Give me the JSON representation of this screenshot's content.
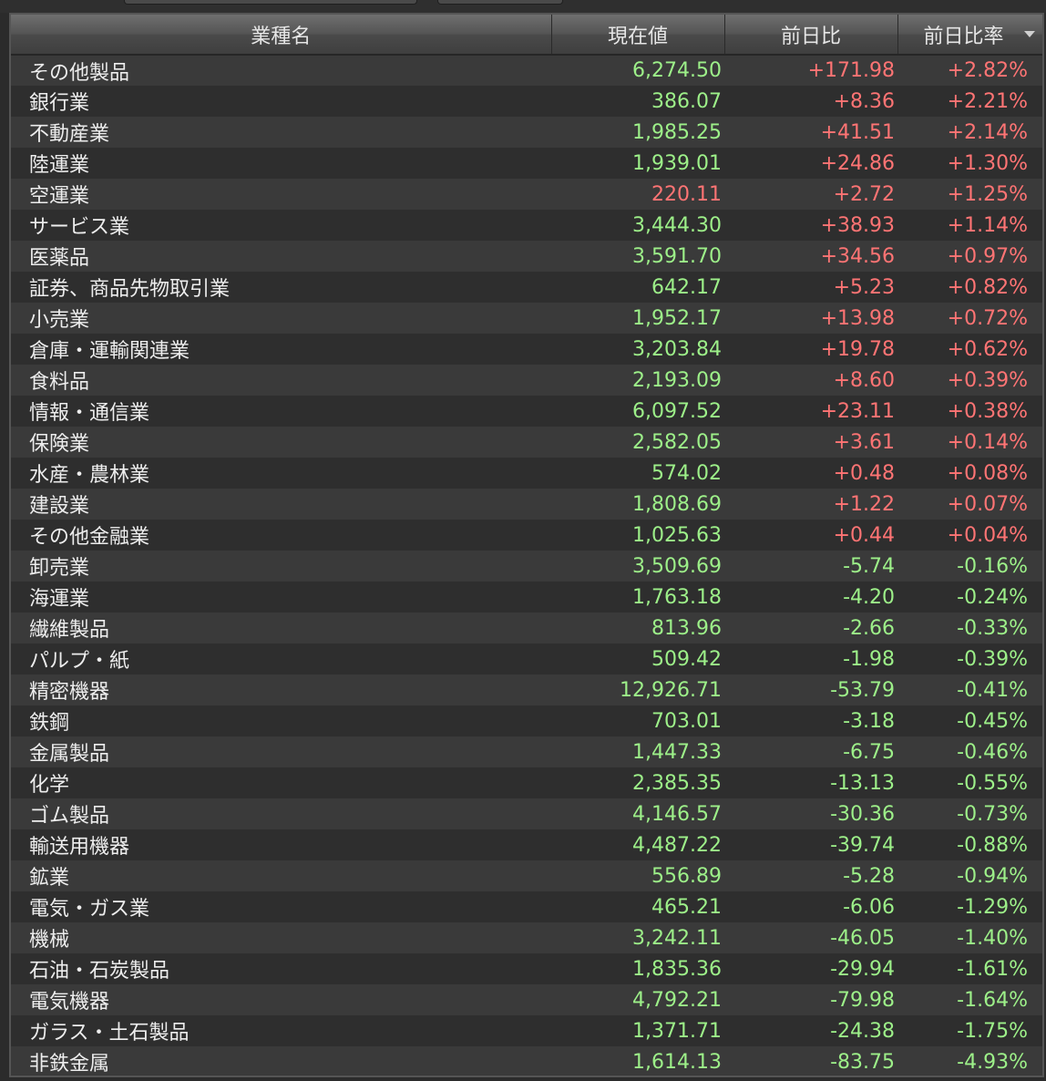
{
  "headers": {
    "name": "業種名",
    "price": "現在値",
    "change": "前日比",
    "pct": "前日比率"
  },
  "colors": {
    "up": "#ff7474",
    "down_or_price": "#9df089"
  },
  "rows": [
    {
      "name": "その他製品",
      "price": "6,274.50",
      "change": "+171.98",
      "pct": "+2.82%",
      "price_color": "green"
    },
    {
      "name": "銀行業",
      "price": "386.07",
      "change": "+8.36",
      "pct": "+2.21%",
      "price_color": "green"
    },
    {
      "name": "不動産業",
      "price": "1,985.25",
      "change": "+41.51",
      "pct": "+2.14%",
      "price_color": "green"
    },
    {
      "name": "陸運業",
      "price": "1,939.01",
      "change": "+24.86",
      "pct": "+1.30%",
      "price_color": "green"
    },
    {
      "name": "空運業",
      "price": "220.11",
      "change": "+2.72",
      "pct": "+1.25%",
      "price_color": "red"
    },
    {
      "name": "サービス業",
      "price": "3,444.30",
      "change": "+38.93",
      "pct": "+1.14%",
      "price_color": "green"
    },
    {
      "name": "医薬品",
      "price": "3,591.70",
      "change": "+34.56",
      "pct": "+0.97%",
      "price_color": "green"
    },
    {
      "name": "証券、商品先物取引業",
      "price": "642.17",
      "change": "+5.23",
      "pct": "+0.82%",
      "price_color": "green"
    },
    {
      "name": "小売業",
      "price": "1,952.17",
      "change": "+13.98",
      "pct": "+0.72%",
      "price_color": "green"
    },
    {
      "name": "倉庫・運輸関連業",
      "price": "3,203.84",
      "change": "+19.78",
      "pct": "+0.62%",
      "price_color": "green"
    },
    {
      "name": "食料品",
      "price": "2,193.09",
      "change": "+8.60",
      "pct": "+0.39%",
      "price_color": "green"
    },
    {
      "name": "情報・通信業",
      "price": "6,097.52",
      "change": "+23.11",
      "pct": "+0.38%",
      "price_color": "green"
    },
    {
      "name": "保険業",
      "price": "2,582.05",
      "change": "+3.61",
      "pct": "+0.14%",
      "price_color": "green"
    },
    {
      "name": "水産・農林業",
      "price": "574.02",
      "change": "+0.48",
      "pct": "+0.08%",
      "price_color": "green"
    },
    {
      "name": "建設業",
      "price": "1,808.69",
      "change": "+1.22",
      "pct": "+0.07%",
      "price_color": "green"
    },
    {
      "name": "その他金融業",
      "price": "1,025.63",
      "change": "+0.44",
      "pct": "+0.04%",
      "price_color": "green"
    },
    {
      "name": "卸売業",
      "price": "3,509.69",
      "change": "-5.74",
      "pct": "-0.16%",
      "price_color": "green"
    },
    {
      "name": "海運業",
      "price": "1,763.18",
      "change": "-4.20",
      "pct": "-0.24%",
      "price_color": "green"
    },
    {
      "name": "繊維製品",
      "price": "813.96",
      "change": "-2.66",
      "pct": "-0.33%",
      "price_color": "green"
    },
    {
      "name": "パルプ・紙",
      "price": "509.42",
      "change": "-1.98",
      "pct": "-0.39%",
      "price_color": "green"
    },
    {
      "name": "精密機器",
      "price": "12,926.71",
      "change": "-53.79",
      "pct": "-0.41%",
      "price_color": "green"
    },
    {
      "name": "鉄鋼",
      "price": "703.01",
      "change": "-3.18",
      "pct": "-0.45%",
      "price_color": "green"
    },
    {
      "name": "金属製品",
      "price": "1,447.33",
      "change": "-6.75",
      "pct": "-0.46%",
      "price_color": "green"
    },
    {
      "name": "化学",
      "price": "2,385.35",
      "change": "-13.13",
      "pct": "-0.55%",
      "price_color": "green"
    },
    {
      "name": "ゴム製品",
      "price": "4,146.57",
      "change": "-30.36",
      "pct": "-0.73%",
      "price_color": "green"
    },
    {
      "name": "輸送用機器",
      "price": "4,487.22",
      "change": "-39.74",
      "pct": "-0.88%",
      "price_color": "green"
    },
    {
      "name": "鉱業",
      "price": "556.89",
      "change": "-5.28",
      "pct": "-0.94%",
      "price_color": "green"
    },
    {
      "name": "電気・ガス業",
      "price": "465.21",
      "change": "-6.06",
      "pct": "-1.29%",
      "price_color": "green"
    },
    {
      "name": "機械",
      "price": "3,242.11",
      "change": "-46.05",
      "pct": "-1.40%",
      "price_color": "green"
    },
    {
      "name": "石油・石炭製品",
      "price": "1,835.36",
      "change": "-29.94",
      "pct": "-1.61%",
      "price_color": "green"
    },
    {
      "name": "電気機器",
      "price": "4,792.21",
      "change": "-79.98",
      "pct": "-1.64%",
      "price_color": "green"
    },
    {
      "name": "ガラス・土石製品",
      "price": "1,371.71",
      "change": "-24.38",
      "pct": "-1.75%",
      "price_color": "green"
    },
    {
      "name": "非鉄金属",
      "price": "1,614.13",
      "change": "-83.75",
      "pct": "-4.93%",
      "price_color": "green"
    }
  ]
}
